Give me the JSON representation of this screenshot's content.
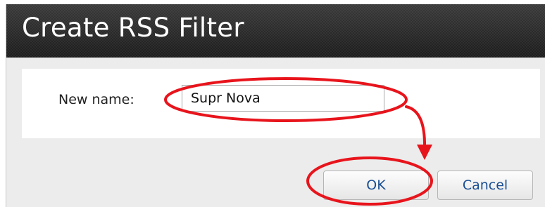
{
  "dialog": {
    "title": "Create RSS Filter",
    "name_label": "New name:",
    "name_value": "Supr Nova",
    "ok_label": "OK",
    "cancel_label": "Cancel"
  },
  "colors": {
    "annotation": "#e8141c",
    "button_text": "#1a4f94",
    "title_bar": "#2b2b2b"
  },
  "annotation": {
    "shapes": [
      "highlight-ellipse",
      "highlight-ellipse",
      "arrow-icon"
    ]
  }
}
